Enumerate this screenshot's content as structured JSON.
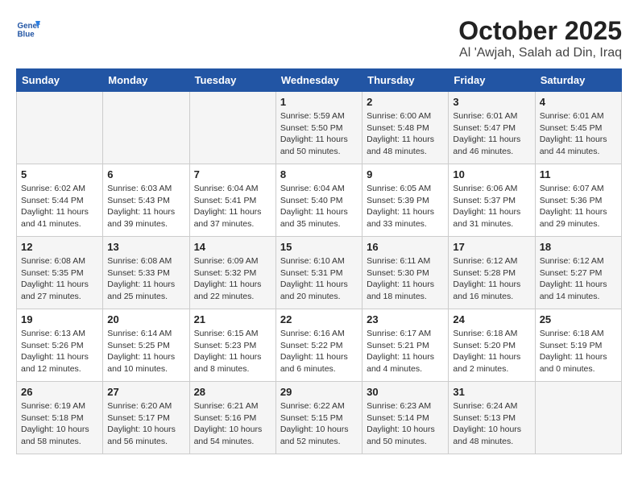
{
  "header": {
    "logo_line1": "General",
    "logo_line2": "Blue",
    "month": "October 2025",
    "location": "Al 'Awjah, Salah ad Din, Iraq"
  },
  "weekdays": [
    "Sunday",
    "Monday",
    "Tuesday",
    "Wednesday",
    "Thursday",
    "Friday",
    "Saturday"
  ],
  "weeks": [
    [
      {
        "day": "",
        "info": ""
      },
      {
        "day": "",
        "info": ""
      },
      {
        "day": "",
        "info": ""
      },
      {
        "day": "1",
        "info": "Sunrise: 5:59 AM\nSunset: 5:50 PM\nDaylight: 11 hours\nand 50 minutes."
      },
      {
        "day": "2",
        "info": "Sunrise: 6:00 AM\nSunset: 5:48 PM\nDaylight: 11 hours\nand 48 minutes."
      },
      {
        "day": "3",
        "info": "Sunrise: 6:01 AM\nSunset: 5:47 PM\nDaylight: 11 hours\nand 46 minutes."
      },
      {
        "day": "4",
        "info": "Sunrise: 6:01 AM\nSunset: 5:45 PM\nDaylight: 11 hours\nand 44 minutes."
      }
    ],
    [
      {
        "day": "5",
        "info": "Sunrise: 6:02 AM\nSunset: 5:44 PM\nDaylight: 11 hours\nand 41 minutes."
      },
      {
        "day": "6",
        "info": "Sunrise: 6:03 AM\nSunset: 5:43 PM\nDaylight: 11 hours\nand 39 minutes."
      },
      {
        "day": "7",
        "info": "Sunrise: 6:04 AM\nSunset: 5:41 PM\nDaylight: 11 hours\nand 37 minutes."
      },
      {
        "day": "8",
        "info": "Sunrise: 6:04 AM\nSunset: 5:40 PM\nDaylight: 11 hours\nand 35 minutes."
      },
      {
        "day": "9",
        "info": "Sunrise: 6:05 AM\nSunset: 5:39 PM\nDaylight: 11 hours\nand 33 minutes."
      },
      {
        "day": "10",
        "info": "Sunrise: 6:06 AM\nSunset: 5:37 PM\nDaylight: 11 hours\nand 31 minutes."
      },
      {
        "day": "11",
        "info": "Sunrise: 6:07 AM\nSunset: 5:36 PM\nDaylight: 11 hours\nand 29 minutes."
      }
    ],
    [
      {
        "day": "12",
        "info": "Sunrise: 6:08 AM\nSunset: 5:35 PM\nDaylight: 11 hours\nand 27 minutes."
      },
      {
        "day": "13",
        "info": "Sunrise: 6:08 AM\nSunset: 5:33 PM\nDaylight: 11 hours\nand 25 minutes."
      },
      {
        "day": "14",
        "info": "Sunrise: 6:09 AM\nSunset: 5:32 PM\nDaylight: 11 hours\nand 22 minutes."
      },
      {
        "day": "15",
        "info": "Sunrise: 6:10 AM\nSunset: 5:31 PM\nDaylight: 11 hours\nand 20 minutes."
      },
      {
        "day": "16",
        "info": "Sunrise: 6:11 AM\nSunset: 5:30 PM\nDaylight: 11 hours\nand 18 minutes."
      },
      {
        "day": "17",
        "info": "Sunrise: 6:12 AM\nSunset: 5:28 PM\nDaylight: 11 hours\nand 16 minutes."
      },
      {
        "day": "18",
        "info": "Sunrise: 6:12 AM\nSunset: 5:27 PM\nDaylight: 11 hours\nand 14 minutes."
      }
    ],
    [
      {
        "day": "19",
        "info": "Sunrise: 6:13 AM\nSunset: 5:26 PM\nDaylight: 11 hours\nand 12 minutes."
      },
      {
        "day": "20",
        "info": "Sunrise: 6:14 AM\nSunset: 5:25 PM\nDaylight: 11 hours\nand 10 minutes."
      },
      {
        "day": "21",
        "info": "Sunrise: 6:15 AM\nSunset: 5:23 PM\nDaylight: 11 hours\nand 8 minutes."
      },
      {
        "day": "22",
        "info": "Sunrise: 6:16 AM\nSunset: 5:22 PM\nDaylight: 11 hours\nand 6 minutes."
      },
      {
        "day": "23",
        "info": "Sunrise: 6:17 AM\nSunset: 5:21 PM\nDaylight: 11 hours\nand 4 minutes."
      },
      {
        "day": "24",
        "info": "Sunrise: 6:18 AM\nSunset: 5:20 PM\nDaylight: 11 hours\nand 2 minutes."
      },
      {
        "day": "25",
        "info": "Sunrise: 6:18 AM\nSunset: 5:19 PM\nDaylight: 11 hours\nand 0 minutes."
      }
    ],
    [
      {
        "day": "26",
        "info": "Sunrise: 6:19 AM\nSunset: 5:18 PM\nDaylight: 10 hours\nand 58 minutes."
      },
      {
        "day": "27",
        "info": "Sunrise: 6:20 AM\nSunset: 5:17 PM\nDaylight: 10 hours\nand 56 minutes."
      },
      {
        "day": "28",
        "info": "Sunrise: 6:21 AM\nSunset: 5:16 PM\nDaylight: 10 hours\nand 54 minutes."
      },
      {
        "day": "29",
        "info": "Sunrise: 6:22 AM\nSunset: 5:15 PM\nDaylight: 10 hours\nand 52 minutes."
      },
      {
        "day": "30",
        "info": "Sunrise: 6:23 AM\nSunset: 5:14 PM\nDaylight: 10 hours\nand 50 minutes."
      },
      {
        "day": "31",
        "info": "Sunrise: 6:24 AM\nSunset: 5:13 PM\nDaylight: 10 hours\nand 48 minutes."
      },
      {
        "day": "",
        "info": ""
      }
    ]
  ]
}
